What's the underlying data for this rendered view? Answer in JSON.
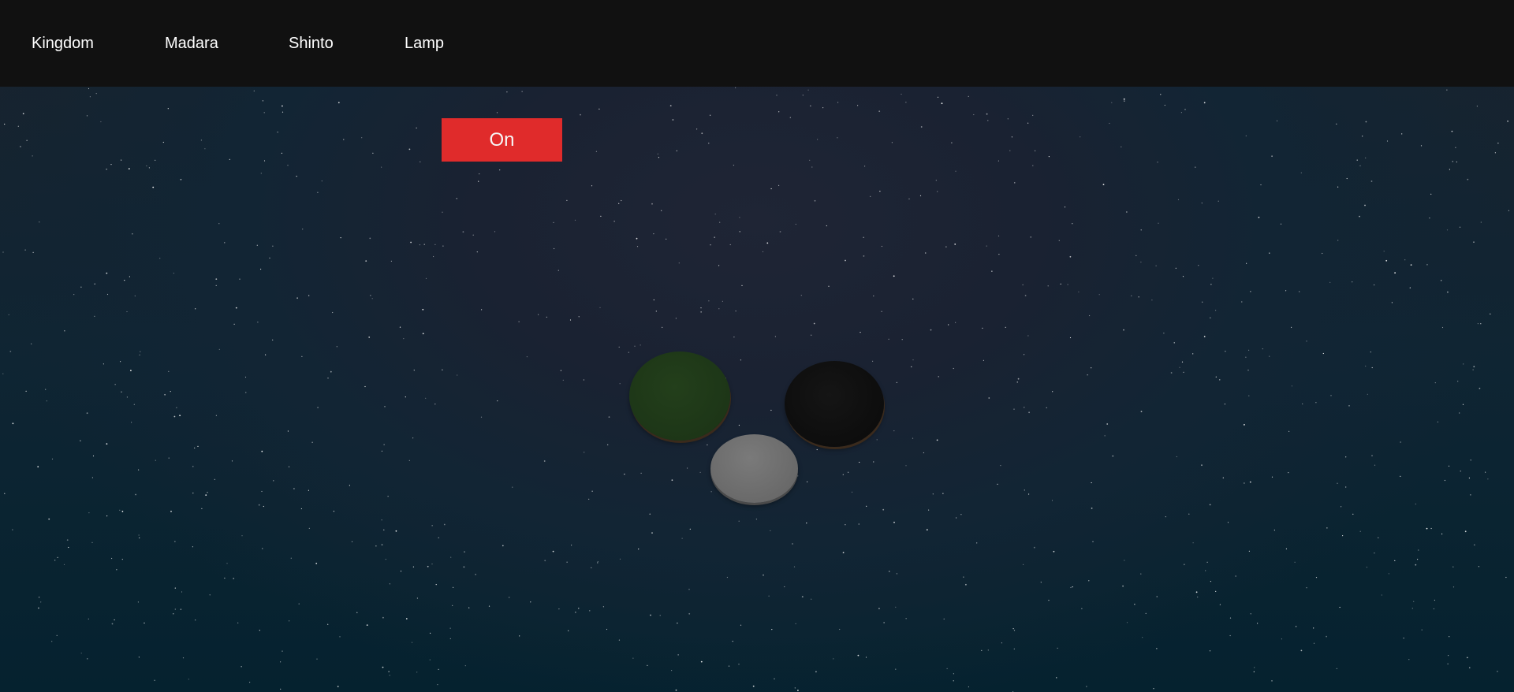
{
  "nav": {
    "items": [
      {
        "label": "Kingdom"
      },
      {
        "label": "Madara"
      },
      {
        "label": "Shinto"
      },
      {
        "label": "Lamp"
      }
    ]
  },
  "toggle": {
    "label": "On",
    "color": "#e02b2b"
  },
  "discs": [
    {
      "name": "green-disc",
      "color": "#1d3617"
    },
    {
      "name": "black-disc",
      "color": "#0d0d0d"
    },
    {
      "name": "grey-disc",
      "color": "#6c6c6c"
    }
  ],
  "colors": {
    "nav_background": "#111111",
    "sky_top": "#1f2535",
    "sky_bottom": "#05222f"
  }
}
